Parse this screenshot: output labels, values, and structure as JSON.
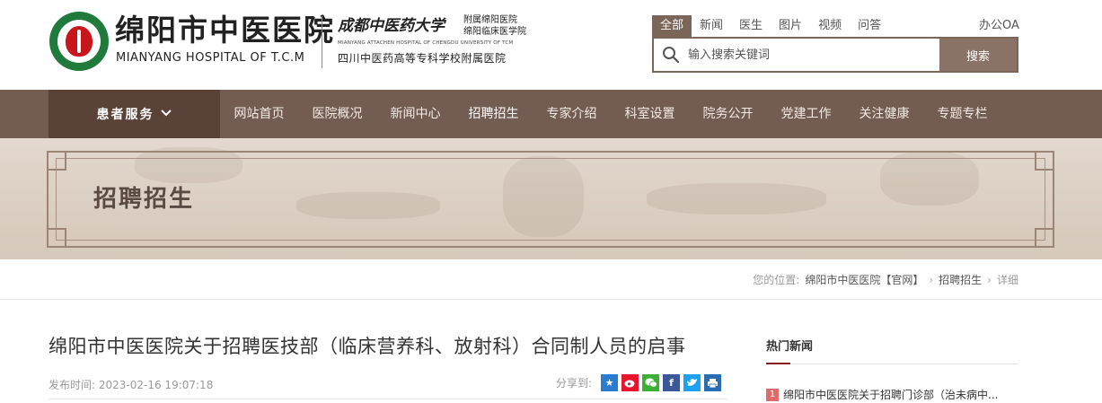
{
  "logo": {
    "name_cn": "绵阳市中医医院",
    "name_en": "MIANYANG HOSPITAL OF T.C.M",
    "university": "成都中医药大学",
    "affiliation": [
      "附属绵阳医院",
      "绵阳临床医学院"
    ],
    "sub_en": "MIANYANG ATTACHEN HOSPITAL OF CHENGDU UNIVERSITY OF TCM",
    "sub_cn": "四川中医药高等专科学校附属医院"
  },
  "search": {
    "tabs": [
      "全部",
      "新闻",
      "医生",
      "图片",
      "视频",
      "问答"
    ],
    "placeholder": "输入搜索关键词",
    "button": "搜索"
  },
  "oa_link": "办公OA",
  "nav": {
    "patient_service": "患者服务",
    "items": [
      "网站首页",
      "医院概况",
      "新闻中心",
      "招聘招生",
      "专家介绍",
      "科室设置",
      "院务公开",
      "党建工作",
      "关注健康",
      "专题专栏"
    ]
  },
  "banner": {
    "title": "招聘招生"
  },
  "breadcrumb": {
    "label": "您的位置:",
    "items": [
      "绵阳市中医医院【官网】",
      "招聘招生",
      "详细"
    ]
  },
  "article": {
    "title": "绵阳市中医医院关于招聘医技部（临床营养科、放射科）合同制人员的启事",
    "publish_label": "发布时间:",
    "publish_time": "2023-02-16 19:07:18",
    "share_label": "分享到:"
  },
  "sidebar": {
    "hot_title": "热门新闻",
    "hot_items": [
      {
        "rank": "1",
        "text": "绵阳市中医医院关于招聘门诊部（治未病中..."
      }
    ]
  },
  "colors": {
    "nav_bg": "#735d52",
    "nav_patient_bg": "#5a4238",
    "search_accent": "#7b6458",
    "rank_badge": "#e06a6a"
  },
  "share_icons": [
    "qzone-icon",
    "weibo-icon",
    "wechat-icon",
    "facebook-icon",
    "twitter-icon",
    "print-icon"
  ]
}
